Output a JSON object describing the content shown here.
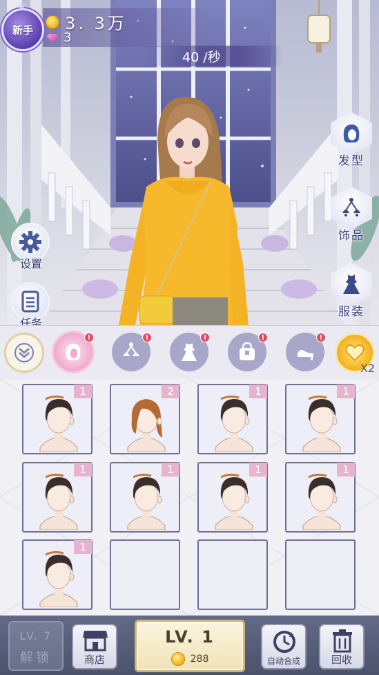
{
  "player": {
    "rank_label": "新手"
  },
  "resources": {
    "coins": "3. 3万",
    "gems": "3",
    "rate": "40 /秒"
  },
  "side_left": [
    {
      "label": "设置",
      "icon": "gear-icon"
    },
    {
      "label": "任务",
      "icon": "clipboard-icon"
    }
  ],
  "side_right": [
    {
      "label": "发型",
      "icon": "hairstyle-icon"
    },
    {
      "label": "饰品",
      "icon": "accessory-icon"
    },
    {
      "label": "服装",
      "icon": "dress-icon"
    }
  ],
  "tabs": [
    {
      "icon": "hair-tab-icon",
      "badge": "!",
      "active": true
    },
    {
      "icon": "accessory-tab-icon",
      "badge": "!",
      "active": false
    },
    {
      "icon": "dress-tab-icon",
      "badge": "!",
      "active": false
    },
    {
      "icon": "bag-tab-icon",
      "badge": "!",
      "active": false
    },
    {
      "icon": "shoe-tab-icon",
      "badge": "!",
      "active": false
    }
  ],
  "gold_multiplier": "X2",
  "grid_items": [
    {
      "level": "1",
      "hair": "dark"
    },
    {
      "level": "2",
      "hair": "brown"
    },
    {
      "level": "1",
      "hair": "dark"
    },
    {
      "level": "1",
      "hair": "dark"
    },
    {
      "level": "1",
      "hair": "dark"
    },
    {
      "level": "1",
      "hair": "dark"
    },
    {
      "level": "1",
      "hair": "dark"
    },
    {
      "level": "1",
      "hair": "dark"
    },
    {
      "level": "1",
      "hair": "dark"
    },
    {
      "level": "",
      "hair": ""
    },
    {
      "level": "",
      "hair": ""
    },
    {
      "level": "",
      "hair": ""
    }
  ],
  "bottom": {
    "unlock_level": "LV. 7",
    "unlock_label": "解锁",
    "shop_label": "商店",
    "upgrade_level": "LV. 1",
    "upgrade_cost": "288",
    "auto_label": "自动合成",
    "recycle_label": "回收"
  },
  "colors": {
    "accent_pink": "#f1a9ce",
    "tab_idle": "#a8a7c9",
    "badge_red": "#e34a63",
    "bottom_bar": "#565d79"
  }
}
